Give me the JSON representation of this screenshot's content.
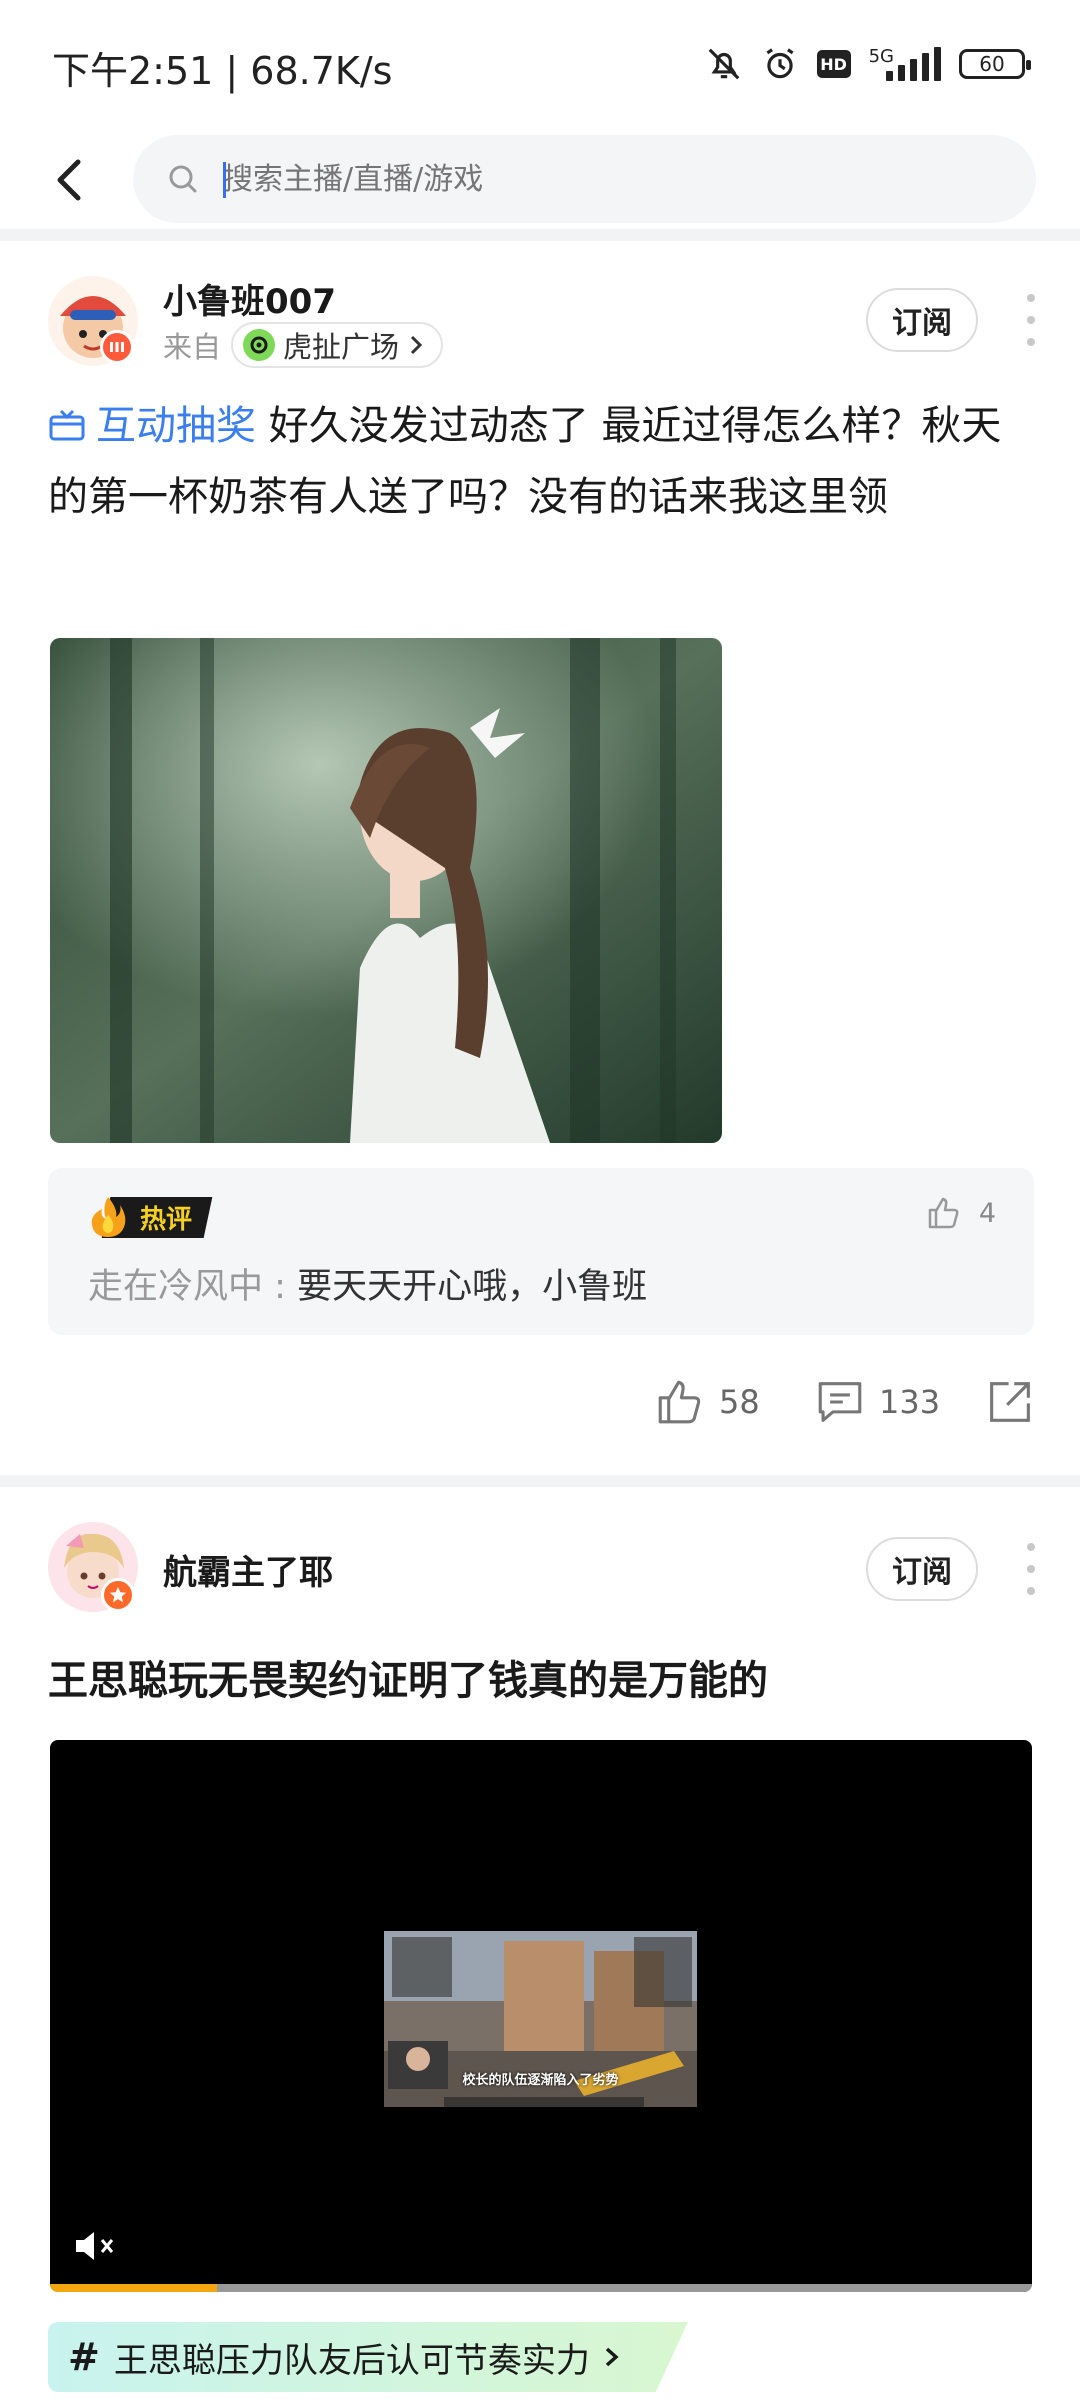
{
  "status_bar": {
    "time": "下午2:51 | 68.7K/s",
    "network": "5G",
    "hd": "HD",
    "battery": "60"
  },
  "search": {
    "placeholder": "搜索主播/直播/游戏"
  },
  "posts": [
    {
      "username": "小鲁班007",
      "from_label": "来自",
      "source": "虎扯广场",
      "subscribe_label": "订阅",
      "tag": "互动抽奖",
      "text": "好久没发过动态了 最近过得怎么样？秋天的第一杯奶茶有人送了吗？没有的话来我这里领",
      "hot_comment": {
        "label": "热评",
        "likes": "4",
        "author": "走在冷风中",
        "separator": " : ",
        "content": "要天天开心哦，小鲁班"
      },
      "likes": "58",
      "comments": "133"
    },
    {
      "username": "航霸主了耶",
      "subscribe_label": "订阅",
      "title": "王思聪玩无畏契约证明了钱真的是万能的",
      "video_caption": "校长的队伍逐渐陷入了劣势",
      "video_progress": 0.17,
      "topic": "王思聪压力队友后认可节奏实力"
    }
  ],
  "colors": {
    "accent_blue": "#3a7ef0",
    "hot_yellow": "#f5d020",
    "progress_orange": "#f3a610"
  }
}
